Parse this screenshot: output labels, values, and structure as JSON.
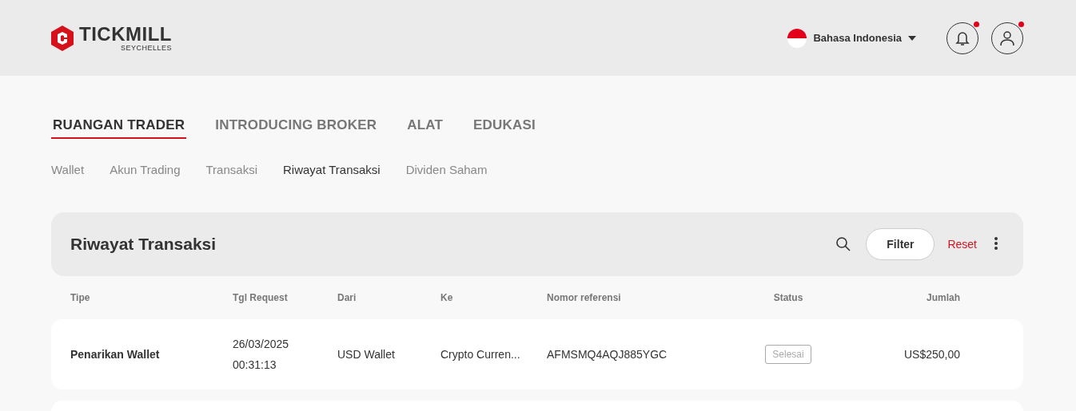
{
  "header": {
    "brand": "TICKMILL",
    "brand_sub": "SEYCHELLES",
    "language": "Bahasa Indonesia",
    "notifications_unread": true,
    "profile_unread": true
  },
  "main_tabs": [
    {
      "label": "RUANGAN TRADER",
      "selected": true
    },
    {
      "label": "INTRODUCING BROKER",
      "selected": false
    },
    {
      "label": "ALAT",
      "selected": false
    },
    {
      "label": "EDUKASI",
      "selected": false
    }
  ],
  "sub_tabs": [
    {
      "label": "Wallet",
      "selected": false
    },
    {
      "label": "Akun Trading",
      "selected": false
    },
    {
      "label": "Transaksi",
      "selected": false
    },
    {
      "label": "Riwayat Transaksi",
      "selected": true
    },
    {
      "label": "Dividen Saham",
      "selected": false
    }
  ],
  "panel": {
    "title": "Riwayat Transaksi",
    "filter": "Filter",
    "reset": "Reset"
  },
  "table": {
    "columns": [
      "Tipe",
      "Tgl Request",
      "Dari",
      "Ke",
      "Nomor referensi",
      "Status",
      "Jumlah"
    ],
    "rows": [
      {
        "type": "Penarikan Wallet",
        "date": "26/03/2025",
        "time": "00:31:13",
        "from": "USD Wallet",
        "to": "Crypto Curren...",
        "reference": "AFMSMQ4AQJ885YGC",
        "status": "Selesai",
        "amount": "US$250,00"
      }
    ],
    "more_rows_below": true
  }
}
